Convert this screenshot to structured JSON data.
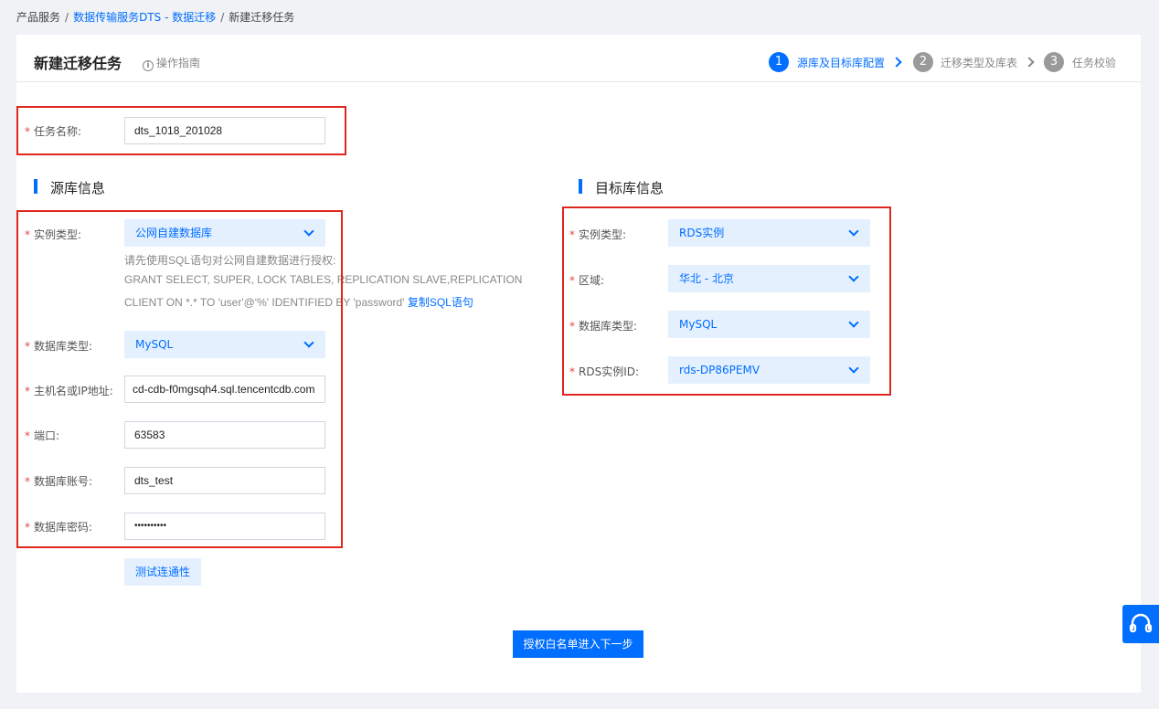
{
  "breadcrumb": {
    "item1": "产品服务",
    "item2": "数据传输服务DTS - 数据迁移",
    "item3": "新建迁移任务",
    "separator": "/"
  },
  "header": {
    "title": "新建迁移任务",
    "guide": "操作指南",
    "guide_icon": "i"
  },
  "steps": [
    {
      "num": "1",
      "label": "源库及目标库配置"
    },
    {
      "num": "2",
      "label": "迁移类型及库表"
    },
    {
      "num": "3",
      "label": "任务校验"
    }
  ],
  "task": {
    "label": "任务名称:",
    "value": "dts_1018_201028"
  },
  "source": {
    "title": "源库信息",
    "instance_type_label": "实例类型:",
    "instance_type_value": "公网自建数据库",
    "hint_line1": "请先使用SQL语句对公网自建数据进行授权:",
    "hint_line2": "GRANT SELECT, SUPER, LOCK TABLES, REPLICATION SLAVE,REPLICATION",
    "hint_line3": "CLIENT ON *.* TO 'user'@'%' IDENTIFIED BY 'password'",
    "copy_sql": "复制SQL语句",
    "db_type_label": "数据库类型:",
    "db_type_value": "MySQL",
    "host_label": "主机名或IP地址:",
    "host_value": "cd-cdb-f0mgsqh4.sql.tencentcdb.com",
    "port_label": "端口:",
    "port_value": "63583",
    "account_label": "数据库账号:",
    "account_value": "dts_test",
    "password_label": "数据库密码:",
    "password_value": "••••••••••",
    "test_button": "测试连通性"
  },
  "target": {
    "title": "目标库信息",
    "instance_type_label": "实例类型:",
    "instance_type_value": "RDS实例",
    "region_label": "区域:",
    "region_value": "华北 - 北京",
    "db_type_label": "数据库类型:",
    "db_type_value": "MySQL",
    "rds_id_label": "RDS实例ID:",
    "rds_id_value": "rds-DP86PEMV"
  },
  "required_mark": "*",
  "next_button": "授权白名单进入下一步",
  "colors": {
    "accent": "#006eff",
    "select_bg": "#e5f0ff",
    "required": "#e54545",
    "annotation_box": "#e0271f"
  }
}
